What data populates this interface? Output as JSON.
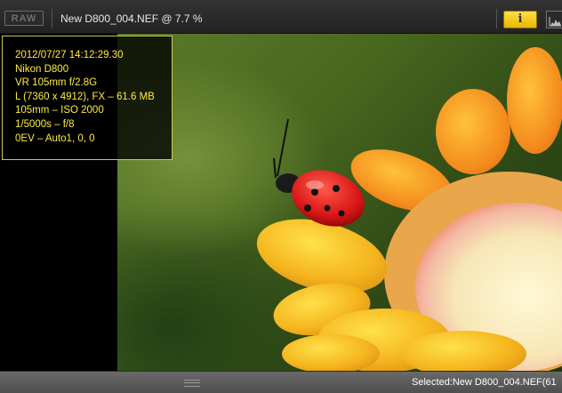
{
  "toolbar": {
    "raw_label": "RAW",
    "title": "New D800_004.NEF @ 7.7 %",
    "info_label": "i"
  },
  "info_panel": {
    "lines": [
      "2012/07/27 14:12:29.30",
      "Nikon D800",
      "VR 105mm f/2.8G",
      "L (7360 x 4912), FX – 61.6 MB",
      "105mm – ISO 2000",
      "1/5000s – f/8",
      "0EV – Auto1, 0, 0"
    ]
  },
  "status": {
    "selected_text": "Selected:New D800_004.NEF(61"
  },
  "colors": {
    "info_text": "#ffec3d",
    "info_border": "#c9c94d",
    "info_button": "#ffdd44"
  }
}
